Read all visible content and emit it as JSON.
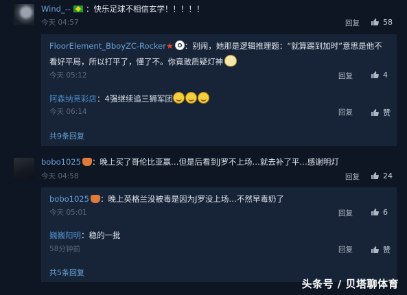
{
  "comments": [
    {
      "user": "Wind_--",
      "text": "：快乐足球不相信玄学！！！！！",
      "time": "今天 04:57",
      "reply_label": "回复",
      "likes": "58",
      "replies": [
        {
          "user": "FloorElement_BboyZC-Rocker",
          "text_line1": "：别闹，她那是逻辑推理题：“就算踢到加时”意思是他不",
          "text_line2": "看好平局，所以打平了，懂了不。你竟敢质疑灯神",
          "time": "今天 05:12",
          "reply_label": "回复",
          "likes": "4"
        },
        {
          "user": "阿森纳竞彩店",
          "text": "：4强继续追三狮军团",
          "time": "今天 06:14",
          "reply_label": "回复",
          "likes": "赞"
        }
      ],
      "expand_label": "共9条回复"
    },
    {
      "user": "bobo1025",
      "text": "：晚上买了哥伦比亚赢…但是后看到J罗不上场…就去补了平…感谢明灯",
      "time": "今天 04:58",
      "reply_label": "回复",
      "likes": "24",
      "replies": [
        {
          "user": "bobo1025",
          "text": "：晚上英格兰没被毒是因为J罗没上场…不然早毒奶了",
          "time": "今天 05:01",
          "reply_label": "回复",
          "likes": "6"
        },
        {
          "user": "巍巍阳明",
          "text": "：稳的一批",
          "time": "58分钟前",
          "reply_label": "回复",
          "likes": "赞"
        }
      ],
      "expand_label": "共5条回复"
    }
  ],
  "watermark": "头条号 / 贝塔聊体育",
  "icons": {
    "flag": "brazil-flag-icon",
    "star": "star-badge-icon",
    "ball": "football-badge-icon",
    "crown": "level-badge-icon",
    "cat": "cat-emoji-icon",
    "smile": "grin-emoji-icon",
    "thumb": "thumbs-up-icon"
  },
  "colors": {
    "background": "#0e1623",
    "reply_box": "#172438",
    "username": "#6aa1d8",
    "text": "#e3e7ee",
    "meta": "#5c6878"
  }
}
